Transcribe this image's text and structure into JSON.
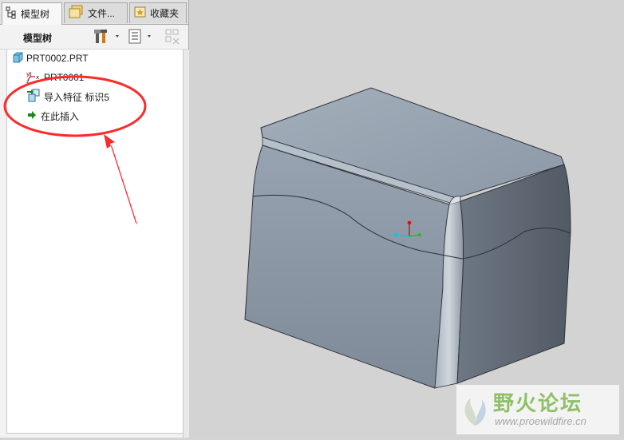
{
  "tabs": [
    {
      "label": "模型树",
      "icon": "tree-structure-icon"
    },
    {
      "label": "文件...",
      "icon": "folder-icon"
    },
    {
      "label": "收藏夹",
      "icon": "favorites-icon"
    }
  ],
  "toolbar": {
    "title": "模型树",
    "buttons": [
      "tree-settings-icon",
      "tree-filter-icon",
      "columns-icon"
    ]
  },
  "tree": {
    "items": [
      {
        "label": "PRT0002.PRT",
        "icon": "part-icon"
      },
      {
        "label": "PRT0001",
        "icon": "csys-icon"
      },
      {
        "label": "导入特征 标识5",
        "icon": "import-feature-icon"
      },
      {
        "label": "在此插入",
        "icon": "insert-here-arrow-icon"
      }
    ]
  },
  "annotation": {
    "color": "#ff2a2a"
  },
  "watermark": {
    "title": "野火论坛",
    "url": "www.proewildfire.cn"
  },
  "colors": {
    "accent_green": "#1a8a1a",
    "model_top": "#9aa5b3",
    "model_front": "#8893a2",
    "model_side": "#5b6570"
  }
}
